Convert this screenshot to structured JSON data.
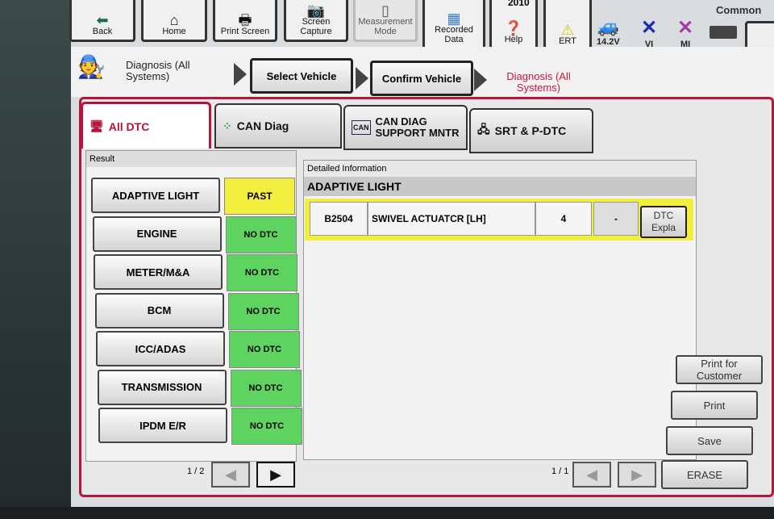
{
  "toolbar": {
    "buttons": [
      {
        "label": "Back",
        "icon": "back-arrow-icon"
      },
      {
        "label": "Home",
        "icon": "home-icon"
      },
      {
        "label": "Print Screen",
        "icon": "printer-icon"
      },
      {
        "label": "Screen Capture",
        "icon": "camera-icon"
      },
      {
        "label": "Measurement Mode",
        "icon": "multimeter-icon",
        "disabled": true
      },
      {
        "label": "Recorded Data",
        "icon": "recorded-data-icon"
      },
      {
        "label": "Help",
        "icon": "help-icon"
      },
      {
        "label": "ERT",
        "icon": "warning-icon"
      }
    ],
    "year": "2010",
    "common": "Common",
    "status": {
      "voltage": "14.2V",
      "vi": "VI",
      "mi": "MI",
      "vi_color": "#1a2bb5",
      "mi_color": "#a23aa8"
    }
  },
  "breadcrumb": {
    "start": "Diagnosis (All Systems)",
    "steps": [
      "Select Vehicle",
      "Confirm Vehicle"
    ],
    "current": "Diagnosis (All Systems)",
    "current_color": "#c8163f"
  },
  "tabs": [
    {
      "label": "All DTC",
      "active": true
    },
    {
      "label": "CAN Diag"
    },
    {
      "label": "CAN DIAG SUPPORT MNTR"
    },
    {
      "label": "SRT & P-DTC"
    }
  ],
  "result": {
    "title": "Result",
    "rows": [
      {
        "system": "ADAPTIVE LIGHT",
        "status": "PAST"
      },
      {
        "system": "ENGINE",
        "status": "NO DTC"
      },
      {
        "system": "METER/M&A",
        "status": "NO DTC"
      },
      {
        "system": "BCM",
        "status": "NO DTC"
      },
      {
        "system": "ICC/ADAS",
        "status": "NO DTC"
      },
      {
        "system": "TRANSMISSION",
        "status": "NO DTC"
      },
      {
        "system": "IPDM E/R",
        "status": "NO DTC"
      }
    ],
    "page": "1 / 2"
  },
  "detail": {
    "title": "Detailed Information",
    "system": "ADAPTIVE LIGHT",
    "dtc": {
      "code": "B2504",
      "description": "SWIVEL ACTUATCR [LH]",
      "count": "4",
      "extra": "-",
      "button": "DTC Expla"
    },
    "page": "1 / 1"
  },
  "side_buttons": [
    "Print for Customer",
    "Print",
    "Save",
    "ERASE"
  ],
  "colors": {
    "accent": "#b5153a",
    "past": "#f1ee3e",
    "no_dtc": "#5fd35f"
  }
}
